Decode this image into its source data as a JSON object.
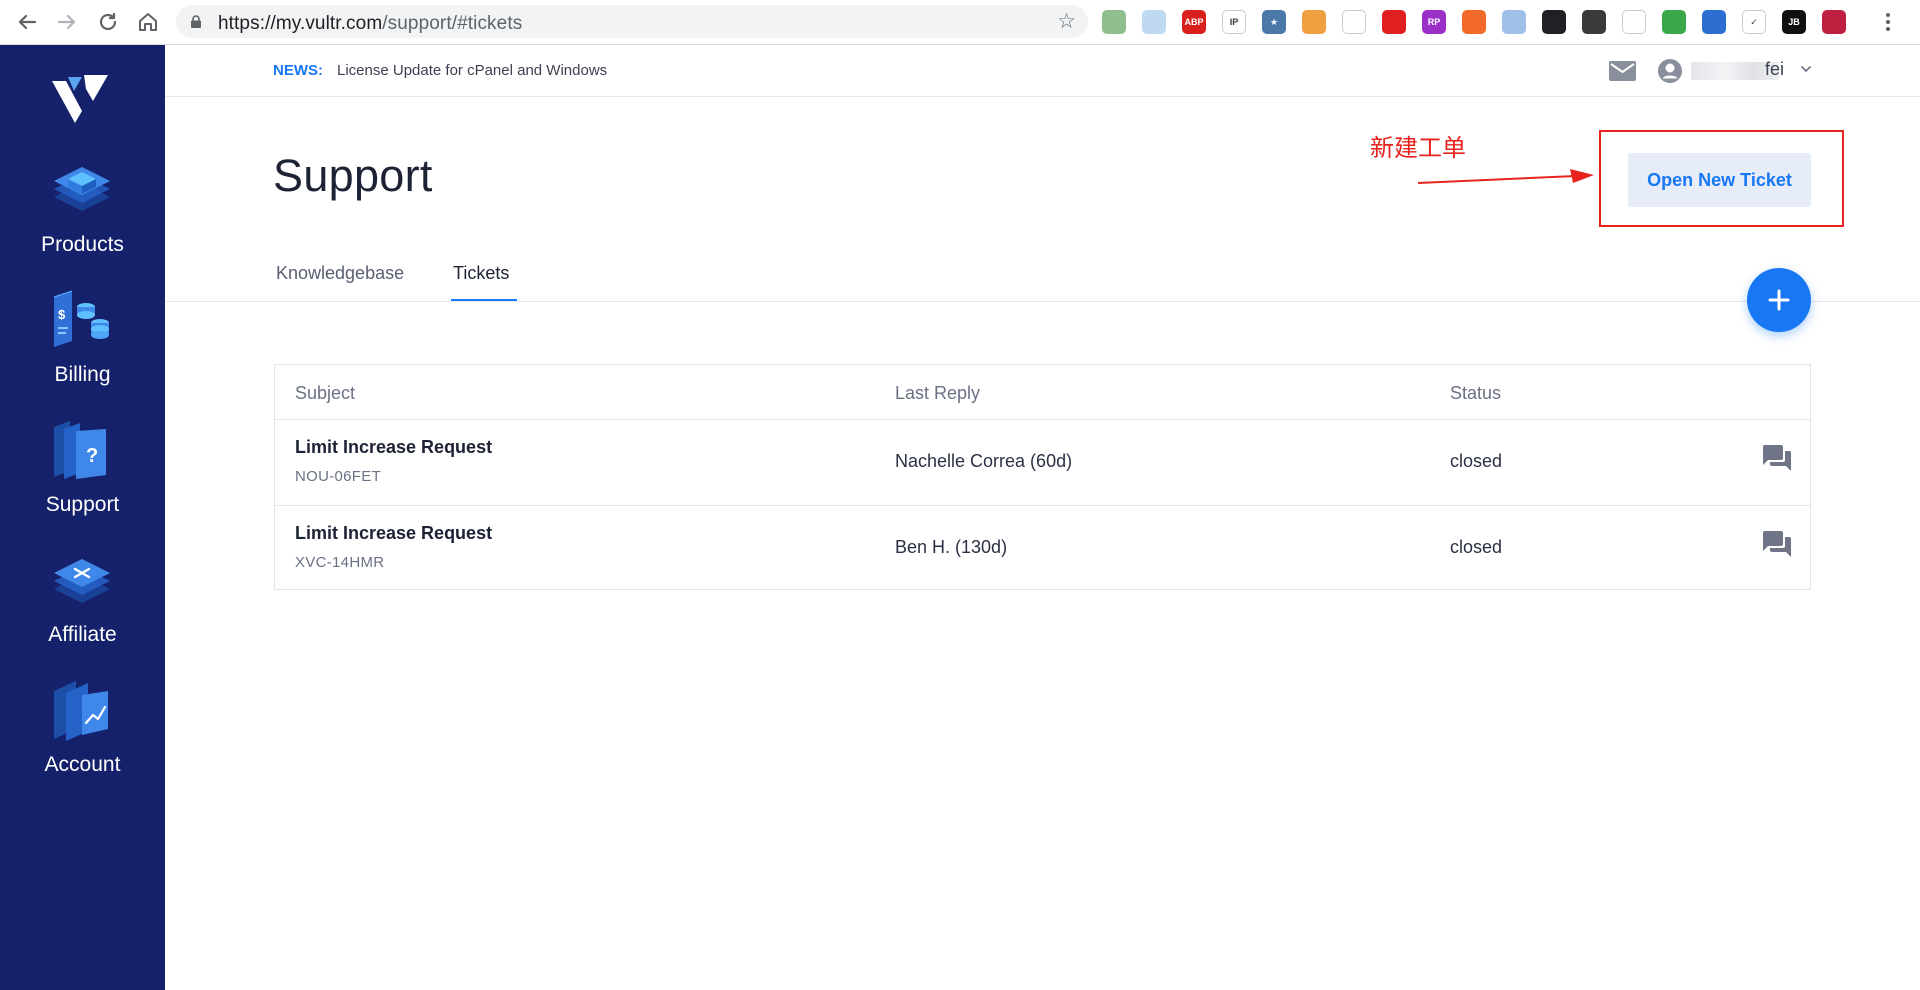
{
  "browser": {
    "url_host": "https://my.vultr.com",
    "url_path": "/support/#tickets",
    "extensions": [
      {
        "name": "green-dot-extension-icon",
        "color": "#8fbf8f",
        "label": ""
      },
      {
        "name": "cloud-extension-icon",
        "color": "#bfd9f0",
        "label": ""
      },
      {
        "name": "adblock-extension-icon",
        "color": "#d9201d",
        "label": "ABP"
      },
      {
        "name": "ip-extension-icon",
        "color": "#ffffff",
        "label": "IP"
      },
      {
        "name": "star-box-extension-icon",
        "color": "#4a78a8",
        "label": "★"
      },
      {
        "name": "fox-extension-icon",
        "color": "#f0a040",
        "label": ""
      },
      {
        "name": "parachute-extension-icon",
        "color": "#ffffff",
        "label": ""
      },
      {
        "name": "red-circle-extension-icon",
        "color": "#e02020",
        "label": ""
      },
      {
        "name": "rp-extension-icon",
        "color": "#9b30c8",
        "label": "RP"
      },
      {
        "name": "weibo-extension-icon",
        "color": "#f26a2a",
        "label": ""
      },
      {
        "name": "blue-swirl-extension-icon",
        "color": "#9fc0e8",
        "label": ""
      },
      {
        "name": "dark-x-extension-icon",
        "color": "#202124",
        "label": ""
      },
      {
        "name": "aperture-extension-icon",
        "color": "#3a3a3a",
        "label": ""
      },
      {
        "name": "cat-extension-icon",
        "color": "#ffffff",
        "label": ""
      },
      {
        "name": "leaf-extension-icon",
        "color": "#3aa848",
        "label": ""
      },
      {
        "name": "globe-extension-icon",
        "color": "#2d6fd0",
        "label": ""
      },
      {
        "name": "check-extension-icon",
        "color": "#ffffff",
        "label": "✓"
      },
      {
        "name": "jb-extension-icon",
        "color": "#101010",
        "label": "JB"
      },
      {
        "name": "profile-extension-icon",
        "color": "#c02040",
        "label": ""
      }
    ]
  },
  "sidebar": {
    "items": [
      {
        "label": "Products"
      },
      {
        "label": "Billing"
      },
      {
        "label": "Support"
      },
      {
        "label": "Affiliate"
      },
      {
        "label": "Account"
      }
    ]
  },
  "header": {
    "news_label": "NEWS:",
    "news_text": "License Update for cPanel and Windows",
    "user_name_visible": "fei"
  },
  "page": {
    "title": "Support",
    "annotation": "新建工单",
    "open_ticket_label": "Open New Ticket",
    "tabs": [
      {
        "label": "Knowledgebase",
        "active": false
      },
      {
        "label": "Tickets",
        "active": true
      }
    ]
  },
  "table": {
    "headers": {
      "subject": "Subject",
      "last_reply": "Last Reply",
      "status": "Status"
    },
    "rows": [
      {
        "subject": "Limit Increase Request",
        "id": "NOU-06FET",
        "last_reply": "Nachelle Correa (60d)",
        "status": "closed"
      },
      {
        "subject": "Limit Increase Request",
        "id": "XVC-14HMR",
        "last_reply": "Ben H. (130d)",
        "status": "closed"
      }
    ]
  },
  "colors": {
    "sidebar": "#15226b",
    "accent": "#1877f2",
    "annotation": "#e8231e"
  }
}
